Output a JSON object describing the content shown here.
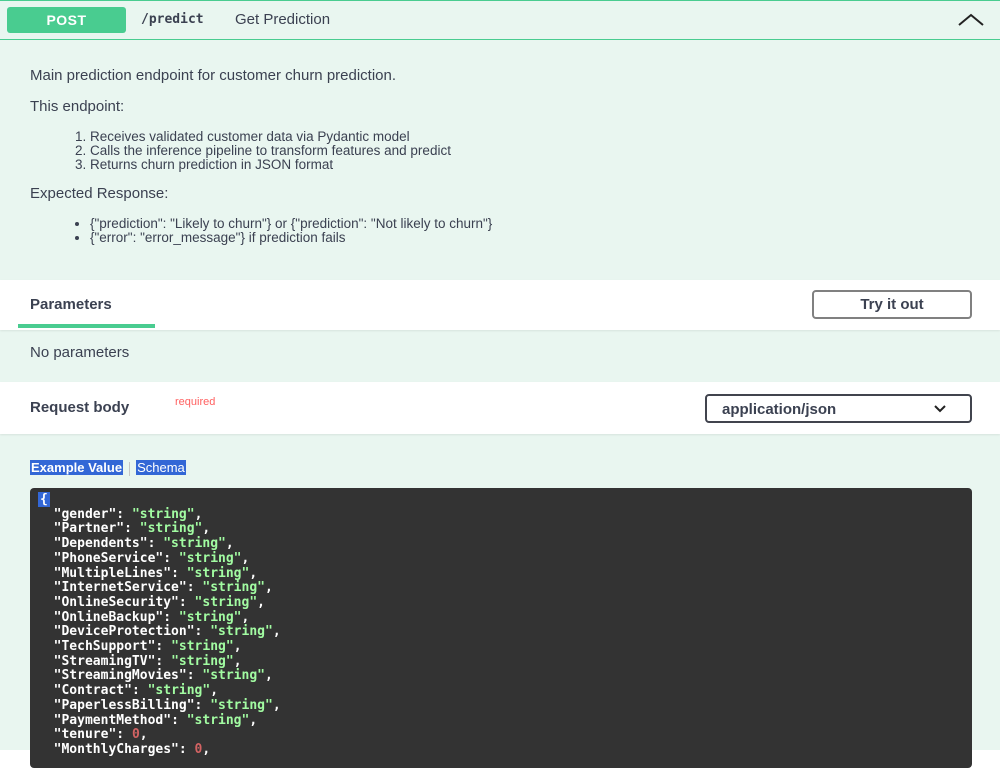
{
  "summary": {
    "method": "POST",
    "path": "/predict",
    "description": "Get Prediction"
  },
  "description": {
    "intro": "Main prediction endpoint for customer churn prediction.",
    "endpoint_heading": "This endpoint:",
    "steps": [
      "Receives validated customer data via Pydantic model",
      "Calls the inference pipeline to transform features and predict",
      "Returns churn prediction in JSON format"
    ],
    "response_heading": "Expected Response:",
    "responses": [
      "{\"prediction\": \"Likely to churn\"} or {\"prediction\": \"Not likely to churn\"}",
      "{\"error\": \"error_message\"} if prediction fails"
    ]
  },
  "parameters": {
    "title": "Parameters",
    "try_label": "Try it out",
    "empty_text": "No parameters"
  },
  "request_body": {
    "title": "Request body",
    "required_label": "required",
    "content_type": "application/json"
  },
  "tabs": {
    "example": "Example Value",
    "schema": "Schema"
  },
  "example": {
    "open_brace": "{",
    "fields": [
      {
        "key": "\"gender\"",
        "value": "\"string\"",
        "type": "string"
      },
      {
        "key": "\"Partner\"",
        "value": "\"string\"",
        "type": "string"
      },
      {
        "key": "\"Dependents\"",
        "value": "\"string\"",
        "type": "string"
      },
      {
        "key": "\"PhoneService\"",
        "value": "\"string\"",
        "type": "string"
      },
      {
        "key": "\"MultipleLines\"",
        "value": "\"string\"",
        "type": "string"
      },
      {
        "key": "\"InternetService\"",
        "value": "\"string\"",
        "type": "string"
      },
      {
        "key": "\"OnlineSecurity\"",
        "value": "\"string\"",
        "type": "string"
      },
      {
        "key": "\"OnlineBackup\"",
        "value": "\"string\"",
        "type": "string"
      },
      {
        "key": "\"DeviceProtection\"",
        "value": "\"string\"",
        "type": "string"
      },
      {
        "key": "\"TechSupport\"",
        "value": "\"string\"",
        "type": "string"
      },
      {
        "key": "\"StreamingTV\"",
        "value": "\"string\"",
        "type": "string"
      },
      {
        "key": "\"StreamingMovies\"",
        "value": "\"string\"",
        "type": "string"
      },
      {
        "key": "\"Contract\"",
        "value": "\"string\"",
        "type": "string"
      },
      {
        "key": "\"PaperlessBilling\"",
        "value": "\"string\"",
        "type": "string"
      },
      {
        "key": "\"PaymentMethod\"",
        "value": "\"string\"",
        "type": "string"
      },
      {
        "key": "\"tenure\"",
        "value": "0",
        "type": "number"
      },
      {
        "key": "\"MonthlyCharges\"",
        "value": "0",
        "type": "number"
      }
    ]
  },
  "colors": {
    "post_green": "#49cc90",
    "block_bg": "#e9f6f0",
    "code_bg": "#333333",
    "string_color": "#a2fca2",
    "number_color": "#d36363",
    "required_color": "#ff6060",
    "selection_blue": "#3367d6"
  }
}
